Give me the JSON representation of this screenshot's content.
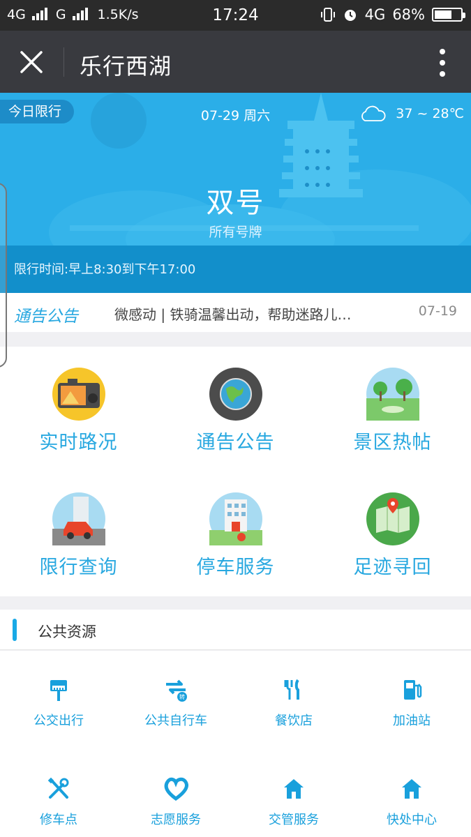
{
  "status_bar": {
    "network_1": "4G",
    "network_2": "G",
    "speed": "1.5K/s",
    "time": "17:24",
    "network_3": "4G",
    "battery": "68%",
    "battery_level": 0.68
  },
  "titlebar": {
    "title": "乐行西湖",
    "close_icon": "close-icon",
    "more_icon": "more-vertical-icon"
  },
  "banner": {
    "tag": "今日限行",
    "date": "07-29 周六",
    "weather_icon": "cloud-icon",
    "temperature": "37 ~ 28℃",
    "plate_rule": "双号",
    "plate_sub": "所有号牌",
    "time_range": "限行时间:早上8:30到下午17:00"
  },
  "notice": {
    "label": "通告公告",
    "text": "微感动 | 铁骑温馨出动，帮助迷路儿…",
    "date": "07-19"
  },
  "main_grid": [
    {
      "label": "实时路况",
      "icon": "camera-icon"
    },
    {
      "label": "通告公告",
      "icon": "globe-icon"
    },
    {
      "label": "景区热帖",
      "icon": "park-icon"
    },
    {
      "label": "限行查询",
      "icon": "car-icon"
    },
    {
      "label": "停车服务",
      "icon": "building-icon"
    },
    {
      "label": "足迹寻回",
      "icon": "map-pin-icon"
    }
  ],
  "section": {
    "title": "公共资源"
  },
  "sub_grid": [
    {
      "label": "公交出行",
      "icon": "bus-stop-icon"
    },
    {
      "label": "公共自行车",
      "icon": "bike-exchange-icon"
    },
    {
      "label": "餐饮店",
      "icon": "fork-knife-icon"
    },
    {
      "label": "加油站",
      "icon": "gas-pump-icon"
    },
    {
      "label": "修车点",
      "icon": "wrench-screwdriver-icon"
    },
    {
      "label": "志愿服务",
      "icon": "heart-icon"
    },
    {
      "label": "交管服务",
      "icon": "home-icon"
    },
    {
      "label": "快处中心",
      "icon": "home-icon"
    }
  ],
  "colors": {
    "accent": "#28a8e0",
    "banner_bg": "#2baee8",
    "titlebar_bg": "#393a3f"
  }
}
